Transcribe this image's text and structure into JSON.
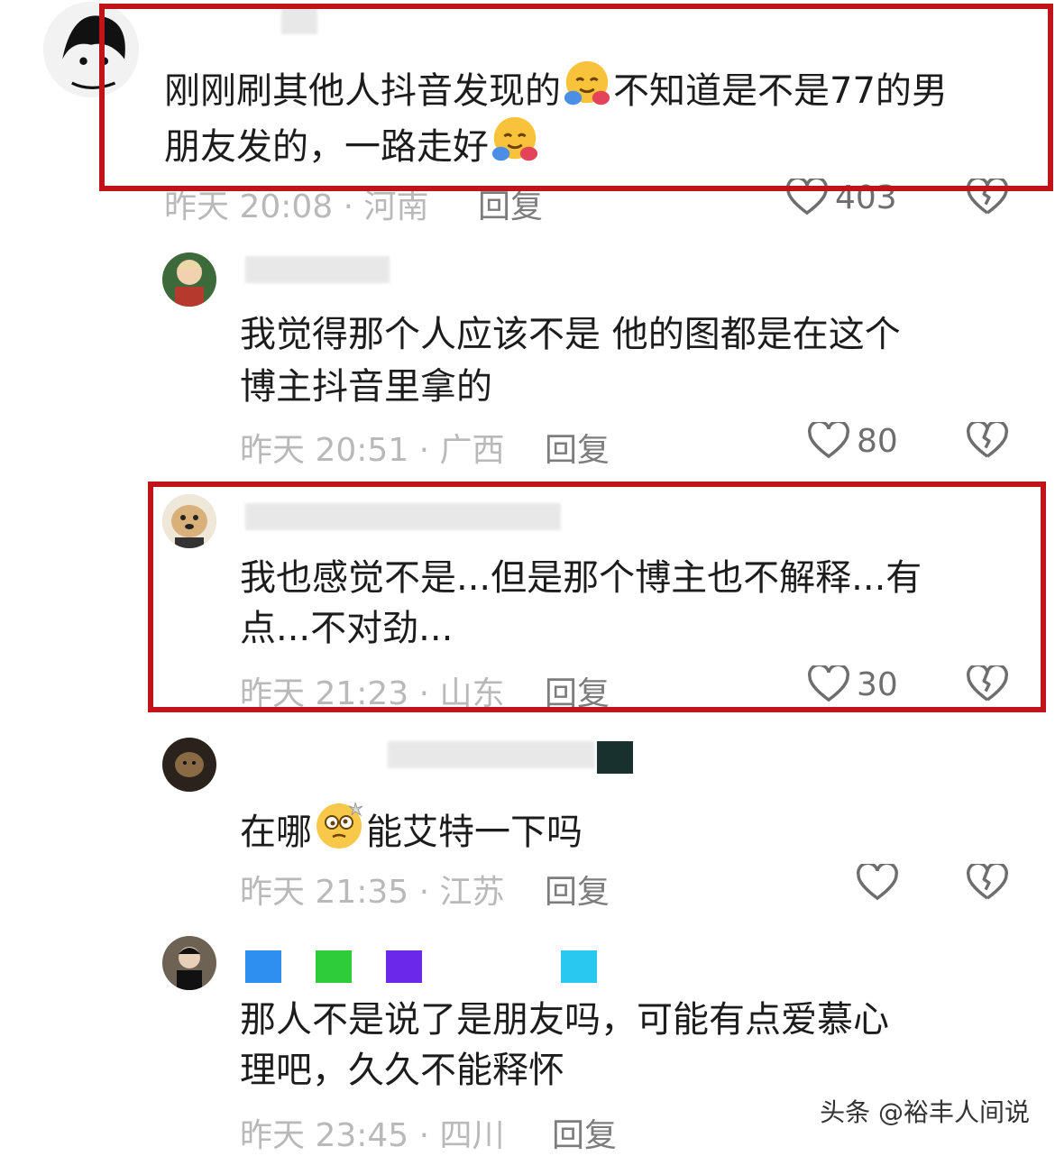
{
  "comments": [
    {
      "text_line1": "刚刚刷其他人抖音发现的",
      "text_line1_tail": "不知道是不是77的男",
      "text_line2": "朋友发的，一路走好",
      "time": "昨天 20:08 · 河南",
      "reply": "回复",
      "likes": "403"
    },
    {
      "text_line1": "我觉得那个人应该不是 他的图都是在这个",
      "text_line2": "博主抖音里拿的",
      "time": "昨天 20:51 · 广西",
      "reply": "回复",
      "likes": "80"
    },
    {
      "text_line1": "我也感觉不是...但是那个博主也不解释...有",
      "text_line2": "点...不对劲...",
      "time": "昨天 21:23 · 山东",
      "reply": "回复",
      "likes": "30"
    },
    {
      "text_pre": "在哪",
      "text_post": "能艾特一下吗",
      "time": "昨天 21:35 · 江苏",
      "reply": "回复",
      "likes": ""
    },
    {
      "text_line1": "那人不是说了是朋友吗，可能有点爱慕心",
      "text_line2": "理吧，久久不能释怀",
      "time": "昨天 23:45 · 四川",
      "reply": "回复",
      "likes": ""
    }
  ],
  "watermark": "头条 @裕丰人间说",
  "colors": {
    "highlight": "#c0141a",
    "meta": "#b9b9b9"
  },
  "icons": {
    "like": "heart-outline-icon",
    "dislike": "broken-heart-icon",
    "hug_emoji": "hugging-face-emoji",
    "dizzy_emoji": "dizzy-face-emoji"
  }
}
